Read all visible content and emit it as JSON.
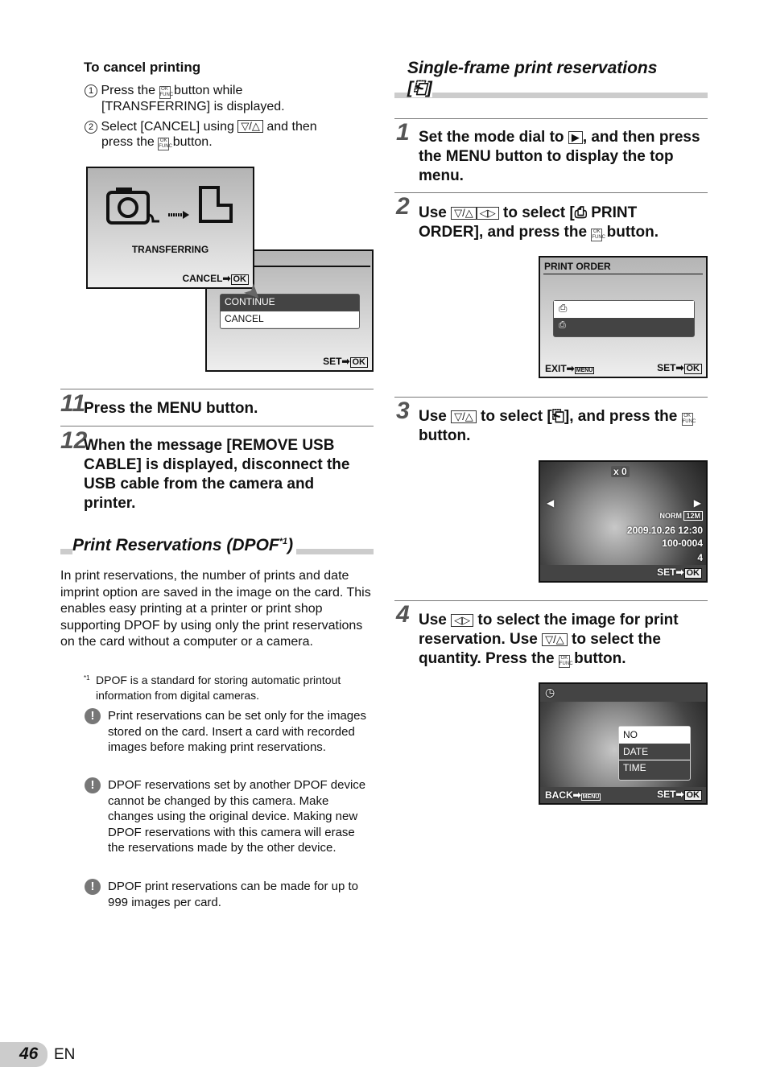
{
  "cancel": {
    "title": "To cancel printing",
    "s1a": "Press the",
    "s1b": "button while",
    "s1c": "[TRANSFERRING]  is displayed.",
    "s2a": "Select [CANCEL] using",
    "s2b": "and then",
    "s2c": "press the",
    "s2d": "button.",
    "screen1": {
      "label": "TRANSFERRING",
      "cancel": "CANCEL",
      "ok": "OK"
    },
    "screen2": {
      "items": [
        "CONTINUE",
        "CANCEL"
      ],
      "set": "SET",
      "ok": "OK"
    }
  },
  "step11": {
    "num": "11",
    "text": "Press the MENU button."
  },
  "step12": {
    "num": "12",
    "text": "When the message [REMOVE USB CABLE] is displayed, disconnect the USB cable from the camera and printer."
  },
  "dpof": {
    "title": "Print Reservations (DPOF",
    "sup": "*1",
    "close": ")",
    "body": "In print reservations, the number of prints and date imprint option are saved in the image on the card. This enables easy printing at a printer or print shop supporting DPOF by using only the print reservations on the card without a computer or a camera.",
    "fn_mark": "*1",
    "footnote": "DPOF is a standard for storing automatic printout information from digital cameras.",
    "notes": [
      "Print reservations can be set only for the images stored on the card. Insert a card with recorded images before making print reservations.",
      "DPOF reservations set by another DPOF device cannot be changed by this camera. Make changes using the original device. Making new DPOF reservations with this camera will erase the reservations made by the other device.",
      "DPOF print reservations can be made for up to 999 images per card."
    ]
  },
  "single": {
    "title": "Single-frame print reservations",
    "title2": "[⎗]"
  },
  "s1": {
    "num": "1",
    "a": "Set the mode dial to",
    "b": ", and then press the MENU button to display the top menu."
  },
  "s2": {
    "num": "2",
    "a": "Use",
    "b": "to select [",
    "c": "PRINT ORDER], and press the",
    "d": "button.",
    "screen": {
      "title": "PRINT ORDER",
      "exit": "EXIT",
      "set": "SET",
      "ok": "OK",
      "menu": "MENU"
    }
  },
  "s3": {
    "num": "3",
    "a": "Use",
    "b": "to select [⎗], and press the",
    "c": "button.",
    "screen": {
      "count": "x  0",
      "norm": "NORM",
      "size": "12M",
      "datetime": "2009.10.26  12:30",
      "file": "100-0004",
      "frame": "4",
      "set": "SET",
      "ok": "OK"
    }
  },
  "s4": {
    "num": "4",
    "a": "Use",
    "b": "to select the image for print reservation. Use",
    "c": "to select the quantity. Press the",
    "d": "button.",
    "screen": {
      "items": [
        "NO",
        "DATE",
        "TIME"
      ],
      "back": "BACK",
      "menu": "MENU",
      "set": "SET",
      "ok": "OK"
    }
  },
  "footer": {
    "page": "46",
    "lang": "EN"
  },
  "icons": {
    "ok_func": "OK FUNC",
    "updown": "▽/△",
    "leftright": "◁▷"
  }
}
